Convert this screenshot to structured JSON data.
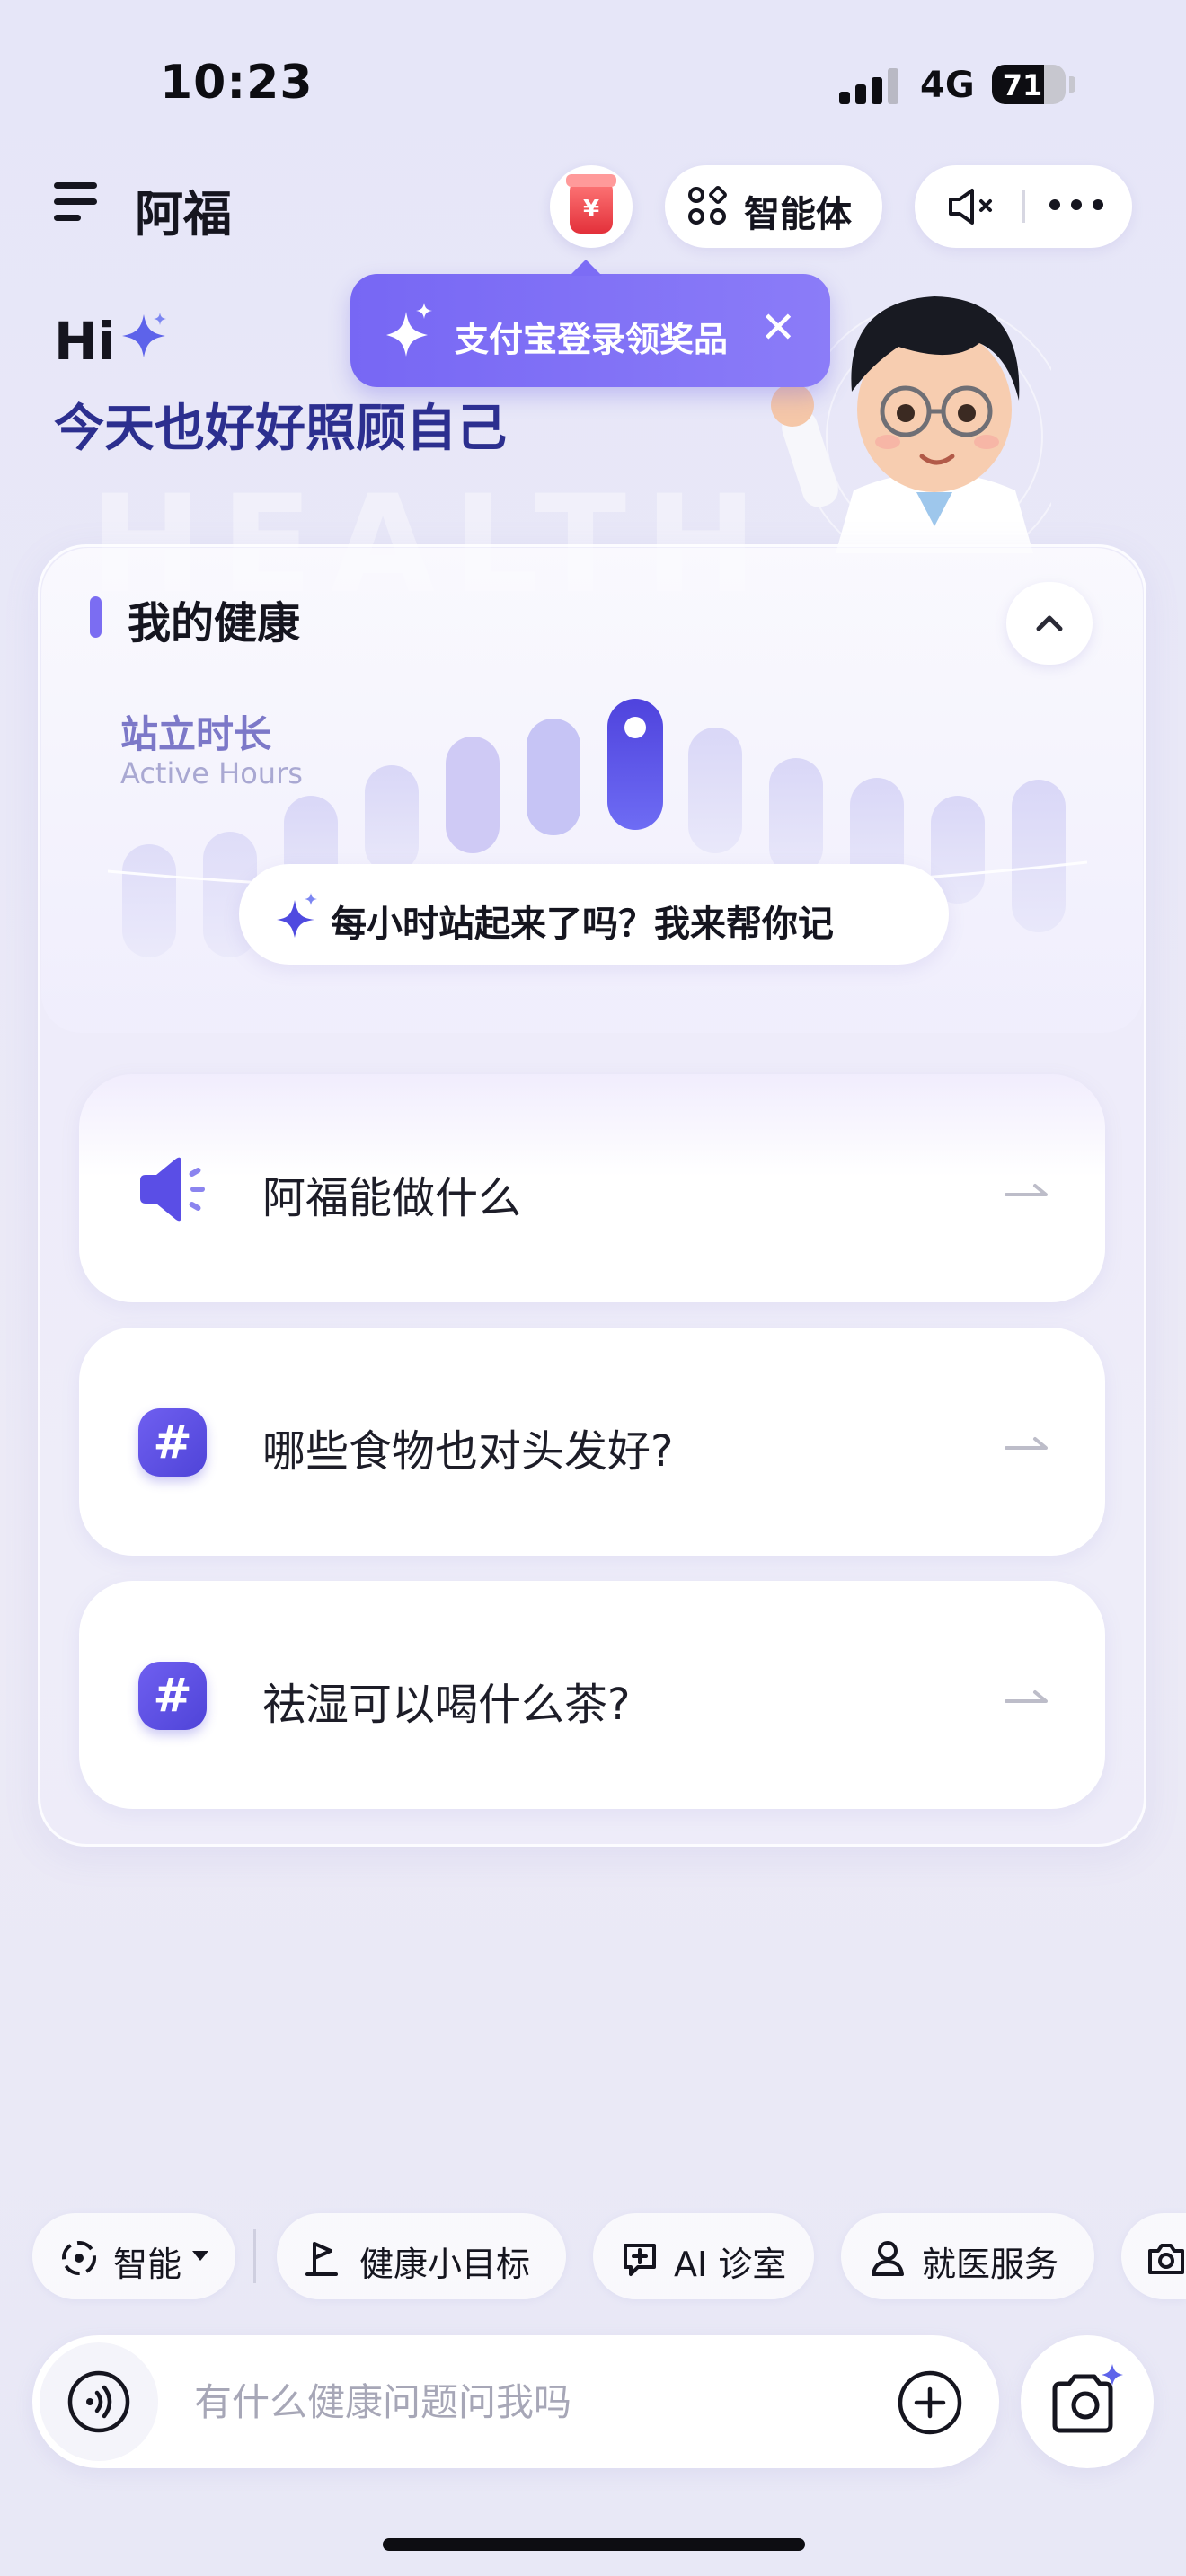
{
  "status_bar": {
    "time": "10:23",
    "network": "4G",
    "battery": "71",
    "battery_level": 0.71
  },
  "header": {
    "title": "阿福",
    "agent_label": "智能体"
  },
  "promo": {
    "text": "支付宝登录领奖品"
  },
  "greeting": {
    "hi": "Hi",
    "subtitle": "今天也好好照顾自己"
  },
  "watermark": "HEALTH",
  "health_card": {
    "title": "我的健康",
    "metric_cn": "站立时长",
    "metric_en": "Active Hours",
    "hint": "每小时站起来了吗？我来帮你记"
  },
  "suggestions": [
    {
      "label": "阿福能做什么",
      "icon": "speaker-icon"
    },
    {
      "label": "哪些食物也对头发好?",
      "icon": "hashtag-icon"
    },
    {
      "label": "祛湿可以喝什么茶?",
      "icon": "hashtag-icon"
    }
  ],
  "chips": [
    {
      "label": "智能"
    },
    {
      "label": "健康小目标"
    },
    {
      "label": "AI 诊室"
    },
    {
      "label": "就医服务"
    }
  ],
  "input": {
    "placeholder": "有什么健康问题问我吗"
  },
  "colors": {
    "accent": "#6f5ff0",
    "subtitle": "#2c2f8f",
    "promo": "#7c6cf5"
  }
}
